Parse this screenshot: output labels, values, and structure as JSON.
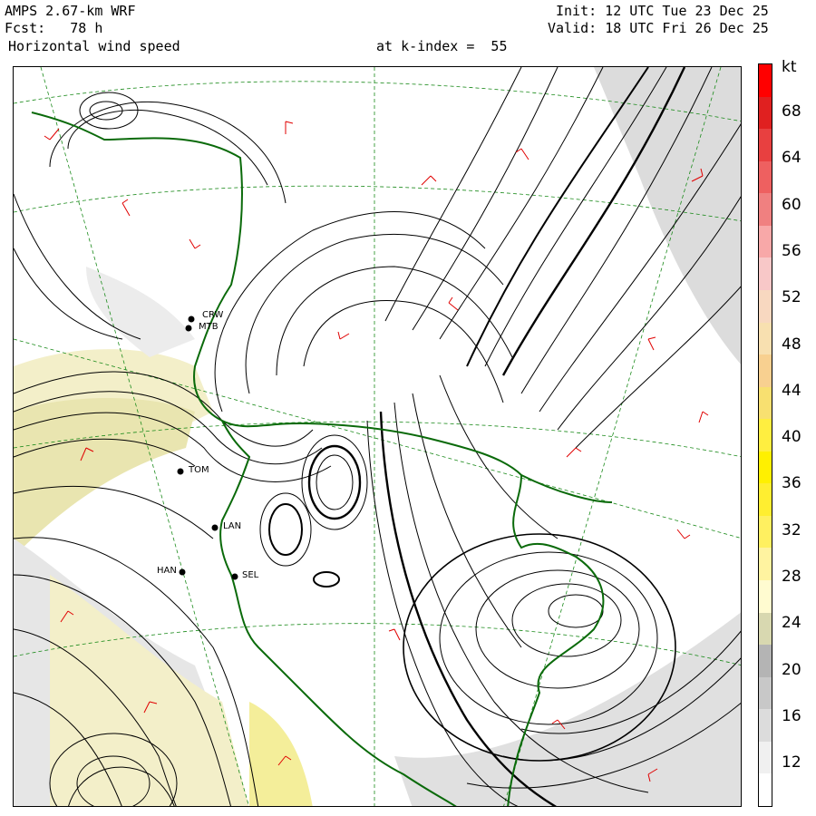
{
  "header": {
    "model": "AMPS 2.67-km WRF",
    "fcst": "Fcst:   78 h",
    "field": "Horizontal wind speed",
    "level": "at k-index =  55",
    "init": "Init: 12 UTC Tue 23 Dec 25",
    "valid": "Valid: 18 UTC Fri 26 Dec 25"
  },
  "colorbar": {
    "unit": "kt",
    "ticks": [
      "68",
      "64",
      "60",
      "56",
      "52",
      "48",
      "44",
      "40",
      "36",
      "32",
      "28",
      "24",
      "20",
      "16",
      "12"
    ],
    "colors": [
      "#ffffff",
      "#f0f0f0",
      "#dcdcdc",
      "#c8c8c8",
      "#b4b4b4",
      "#d8d8b0",
      "#fffbd0",
      "#fff3a0",
      "#fff060",
      "#ffee30",
      "#fff000",
      "#ffee40",
      "#f8e070",
      "#f8d090",
      "#f8e0b0",
      "#f8d8c0",
      "#f8c8c8",
      "#f8a8a8",
      "#f08080",
      "#ee6060",
      "#e84040",
      "#e02020",
      "#ff0000"
    ]
  },
  "stations": [
    {
      "id": "CRW",
      "label": "CRW"
    },
    {
      "id": "MTB",
      "label": "MTB"
    },
    {
      "id": "TOM",
      "label": "TOM"
    },
    {
      "id": "LAN",
      "label": "LAN"
    },
    {
      "id": "HAN",
      "label": "HAN"
    },
    {
      "id": "SEL",
      "label": "SEL"
    }
  ]
}
